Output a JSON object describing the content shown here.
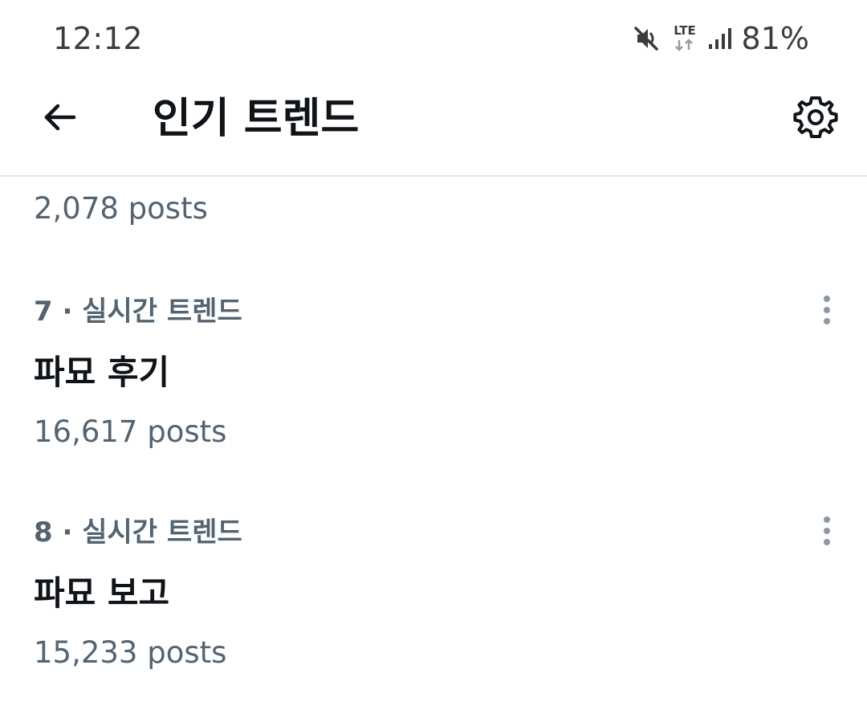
{
  "status_bar": {
    "time": "12:12",
    "network_label": "LTE",
    "battery": "81%",
    "icons": [
      "mute-icon",
      "lte-data-icon",
      "signal-icon"
    ]
  },
  "header": {
    "title": "인기 트렌드",
    "back_icon": "arrow-left-icon",
    "settings_icon": "gear-icon"
  },
  "trends": {
    "partial_previous_count": "2,078 posts",
    "items": [
      {
        "meta": "7 · 실시간 트렌드",
        "name": "파묘 후기",
        "count": "16,617 posts"
      },
      {
        "meta": "8 · 실시간 트렌드",
        "name": "파묘 보고",
        "count": "15,233 posts"
      }
    ]
  },
  "colors": {
    "primary_text": "#0f1419",
    "secondary_text": "#536471",
    "divider": "#e3e7ea",
    "more_icon": "#8b98a5"
  }
}
